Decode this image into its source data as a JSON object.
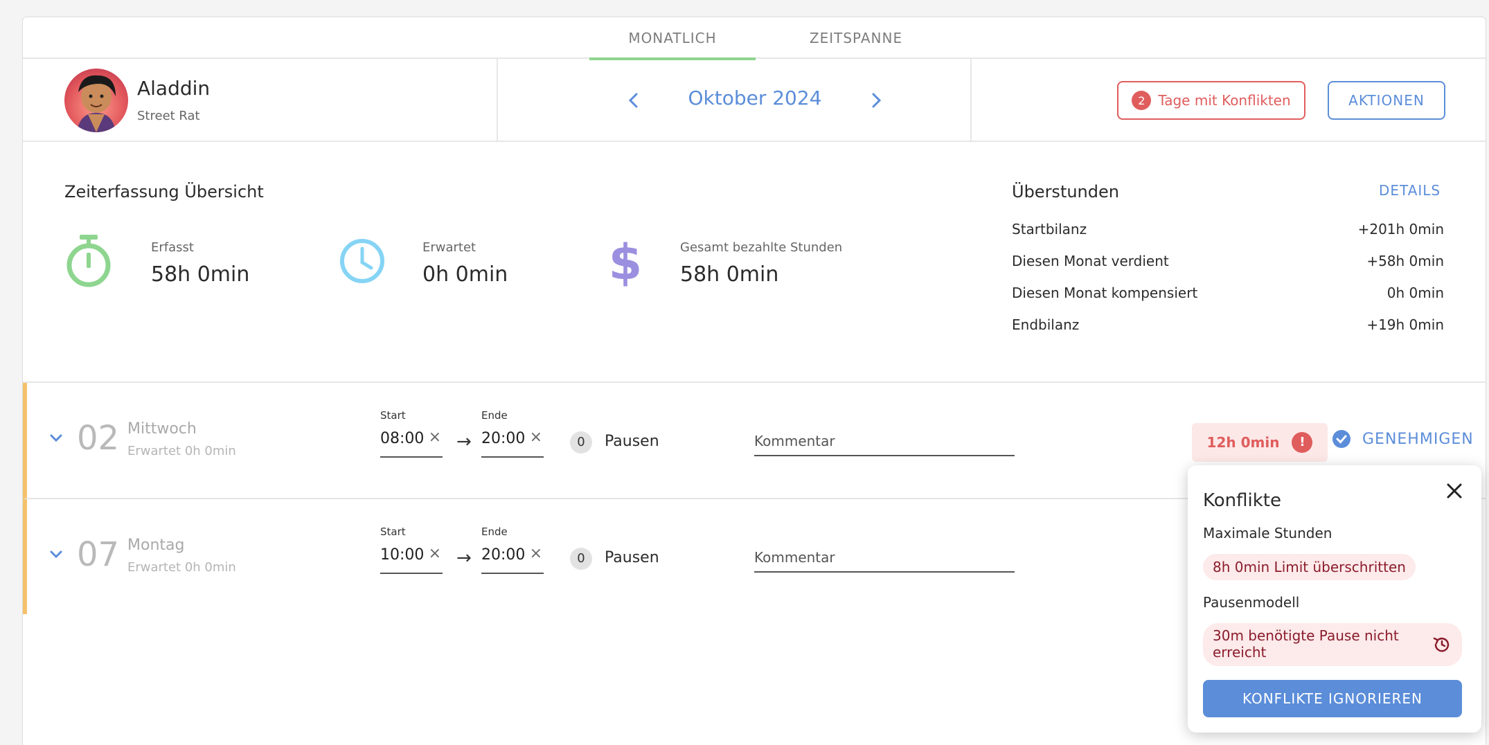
{
  "tabs": [
    {
      "label": "MONATLICH",
      "active": true
    },
    {
      "label": "ZEITSPANNE",
      "active": false
    }
  ],
  "user": {
    "name": "Aladdin",
    "subtitle": "Street Rat"
  },
  "month": {
    "label": "Oktober 2024"
  },
  "header": {
    "conflict_count": "2",
    "conflict_label": "Tage mit Konflikten",
    "actions_label": "AKTIONEN"
  },
  "overview": {
    "title": "Zeiterfassung Übersicht",
    "stats": [
      {
        "label": "Erfasst",
        "value": "58h 0min",
        "icon": "stopwatch-icon",
        "color": "#8ed58f"
      },
      {
        "label": "Erwartet",
        "value": "0h 0min",
        "icon": "clock-icon",
        "color": "#86d4f5"
      },
      {
        "label": "Gesamt bezahlte Stunden",
        "value": "58h 0min",
        "icon": "dollar-icon",
        "color": "#9b8fe0"
      }
    ]
  },
  "overtime": {
    "title": "Überstunden",
    "details_label": "DETAILS",
    "rows": [
      {
        "label": "Startbilanz",
        "value": "+201h 0min"
      },
      {
        "label": "Diesen Monat verdient",
        "value": "+58h 0min"
      },
      {
        "label": "Diesen Monat kompensiert",
        "value": "0h 0min"
      },
      {
        "label": "Endbilanz",
        "value": "+19h 0min"
      }
    ]
  },
  "days": [
    {
      "day_num": "02",
      "day_name": "Mittwoch",
      "expected": "Erwartet 0h 0min",
      "start_label": "Start",
      "start": "08:00",
      "end_label": "Ende",
      "end": "20:00",
      "arrow": "→",
      "pauses_count": "0",
      "pauses_label": "Pausen",
      "comment_placeholder": "Kommentar",
      "hours": "12h 0min",
      "warn": "!",
      "approve_label": "GENEHMIGEN"
    },
    {
      "day_num": "07",
      "day_name": "Montag",
      "expected": "Erwartet 0h 0min",
      "start_label": "Start",
      "start": "10:00",
      "end_label": "Ende",
      "end": "20:00",
      "arrow": "→",
      "pauses_count": "0",
      "pauses_label": "Pausen",
      "comment_placeholder": "Kommentar"
    }
  ],
  "clear_glyph": "×",
  "popup": {
    "title": "Konflikte",
    "section1": "Maximale Stunden",
    "chip1": "8h 0min Limit überschritten",
    "section2": "Pausenmodell",
    "chip2": "30m benötigte Pause nicht erreicht",
    "button": "KONFLIKTE IGNORIEREN"
  },
  "colors": {
    "accent": "#5b8dd9",
    "danger": "#e05d5d",
    "tab_active": "#8ed58f",
    "row_marker": "#f5c26b"
  }
}
